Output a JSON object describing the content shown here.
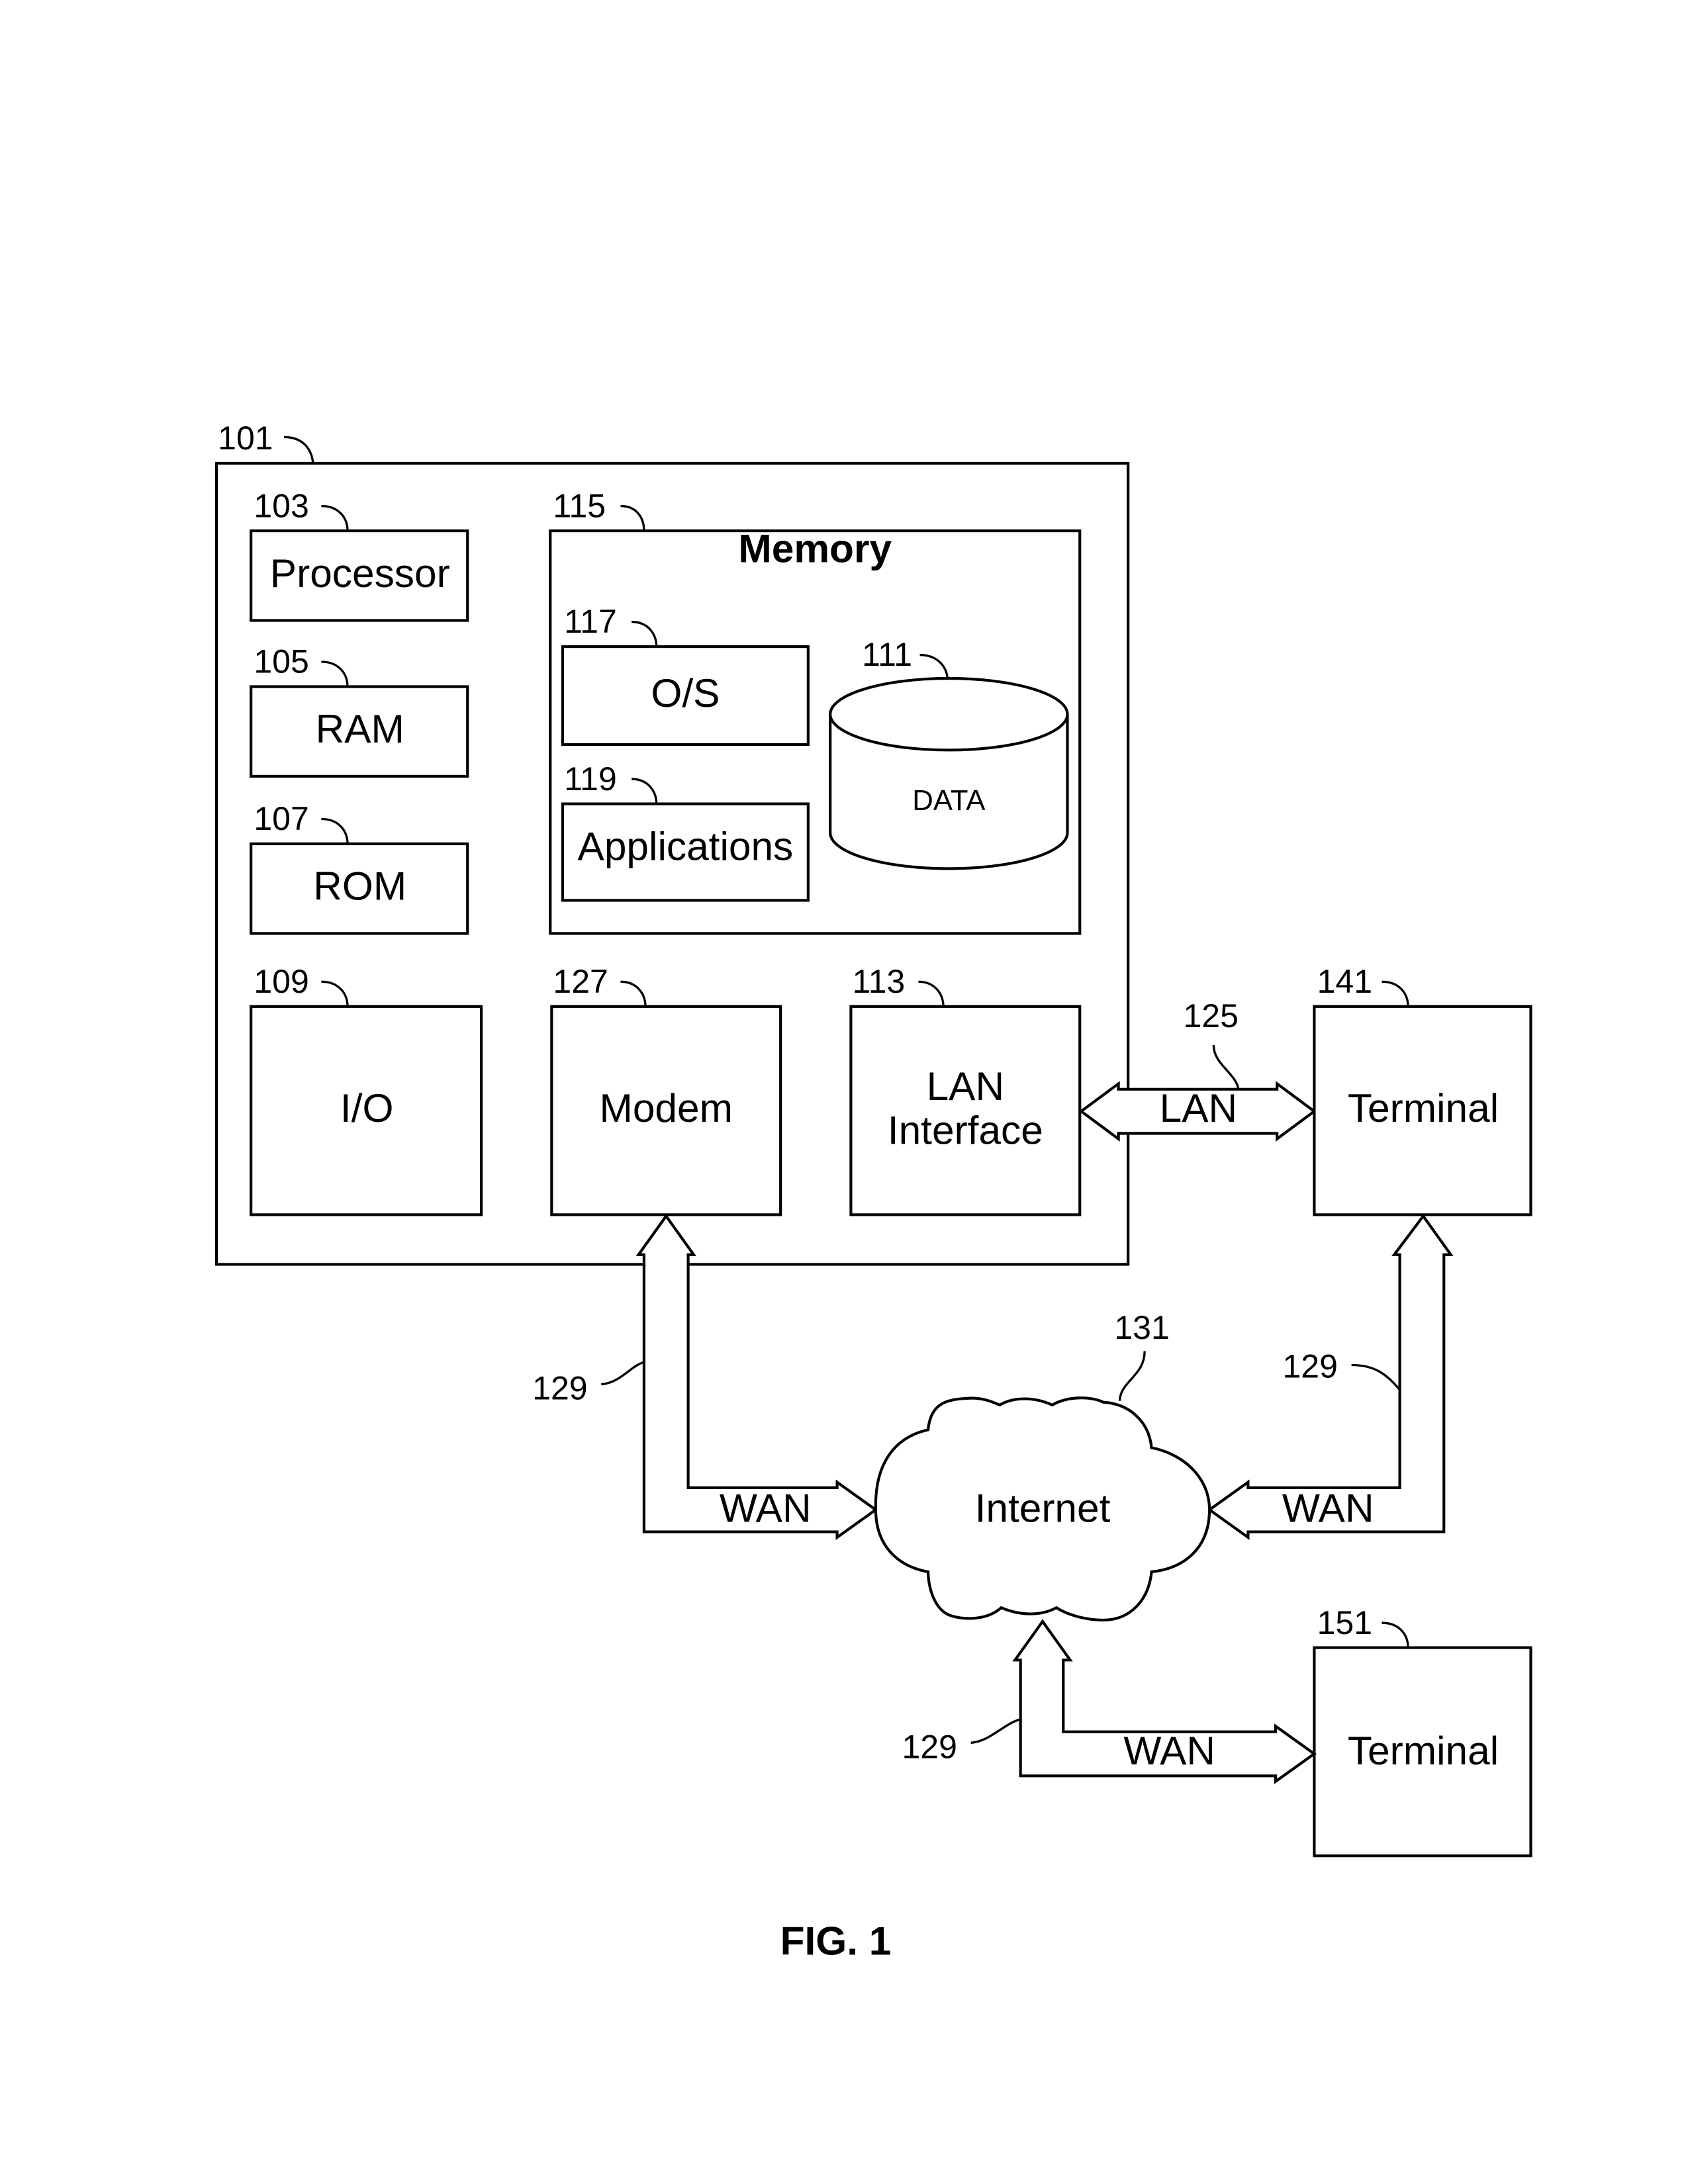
{
  "figure": {
    "caption": "FIG. 1",
    "computer": {
      "ref": "101",
      "processor": {
        "ref": "103",
        "label": "Processor"
      },
      "ram": {
        "ref": "105",
        "label": "RAM"
      },
      "rom": {
        "ref": "107",
        "label": "ROM"
      },
      "io": {
        "ref": "109",
        "label": "I/O"
      },
      "memory": {
        "ref": "115",
        "title": "Memory",
        "os": {
          "ref": "117",
          "label": "O/S"
        },
        "applications": {
          "ref": "119",
          "label": "Applications"
        },
        "data": {
          "ref": "111",
          "label": "DATA"
        }
      },
      "modem": {
        "ref": "127",
        "label": "Modem"
      },
      "lan_interface": {
        "ref": "113",
        "label_line1": "LAN",
        "label_line2": "Interface"
      }
    },
    "lan_link": {
      "ref": "125",
      "label": "LAN"
    },
    "terminal_1": {
      "ref": "141",
      "label": "Terminal"
    },
    "terminal_2": {
      "ref": "151",
      "label": "Terminal"
    },
    "internet": {
      "ref": "131",
      "label": "Internet"
    },
    "wan_links": [
      {
        "ref": "129",
        "label": "WAN"
      },
      {
        "ref": "129",
        "label": "WAN"
      },
      {
        "ref": "129",
        "label": "WAN"
      }
    ]
  }
}
